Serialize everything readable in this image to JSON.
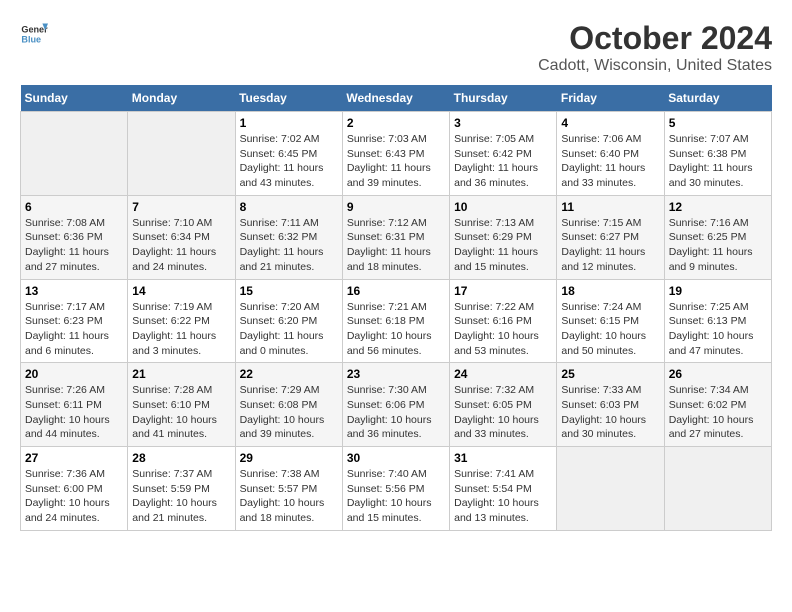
{
  "header": {
    "logo_line1": "General",
    "logo_line2": "Blue",
    "title": "October 2024",
    "subtitle": "Cadott, Wisconsin, United States"
  },
  "weekdays": [
    "Sunday",
    "Monday",
    "Tuesday",
    "Wednesday",
    "Thursday",
    "Friday",
    "Saturday"
  ],
  "weeks": [
    [
      {
        "day": "",
        "info": ""
      },
      {
        "day": "",
        "info": ""
      },
      {
        "day": "1",
        "info": "Sunrise: 7:02 AM\nSunset: 6:45 PM\nDaylight: 11 hours and 43 minutes."
      },
      {
        "day": "2",
        "info": "Sunrise: 7:03 AM\nSunset: 6:43 PM\nDaylight: 11 hours and 39 minutes."
      },
      {
        "day": "3",
        "info": "Sunrise: 7:05 AM\nSunset: 6:42 PM\nDaylight: 11 hours and 36 minutes."
      },
      {
        "day": "4",
        "info": "Sunrise: 7:06 AM\nSunset: 6:40 PM\nDaylight: 11 hours and 33 minutes."
      },
      {
        "day": "5",
        "info": "Sunrise: 7:07 AM\nSunset: 6:38 PM\nDaylight: 11 hours and 30 minutes."
      }
    ],
    [
      {
        "day": "6",
        "info": "Sunrise: 7:08 AM\nSunset: 6:36 PM\nDaylight: 11 hours and 27 minutes."
      },
      {
        "day": "7",
        "info": "Sunrise: 7:10 AM\nSunset: 6:34 PM\nDaylight: 11 hours and 24 minutes."
      },
      {
        "day": "8",
        "info": "Sunrise: 7:11 AM\nSunset: 6:32 PM\nDaylight: 11 hours and 21 minutes."
      },
      {
        "day": "9",
        "info": "Sunrise: 7:12 AM\nSunset: 6:31 PM\nDaylight: 11 hours and 18 minutes."
      },
      {
        "day": "10",
        "info": "Sunrise: 7:13 AM\nSunset: 6:29 PM\nDaylight: 11 hours and 15 minutes."
      },
      {
        "day": "11",
        "info": "Sunrise: 7:15 AM\nSunset: 6:27 PM\nDaylight: 11 hours and 12 minutes."
      },
      {
        "day": "12",
        "info": "Sunrise: 7:16 AM\nSunset: 6:25 PM\nDaylight: 11 hours and 9 minutes."
      }
    ],
    [
      {
        "day": "13",
        "info": "Sunrise: 7:17 AM\nSunset: 6:23 PM\nDaylight: 11 hours and 6 minutes."
      },
      {
        "day": "14",
        "info": "Sunrise: 7:19 AM\nSunset: 6:22 PM\nDaylight: 11 hours and 3 minutes."
      },
      {
        "day": "15",
        "info": "Sunrise: 7:20 AM\nSunset: 6:20 PM\nDaylight: 11 hours and 0 minutes."
      },
      {
        "day": "16",
        "info": "Sunrise: 7:21 AM\nSunset: 6:18 PM\nDaylight: 10 hours and 56 minutes."
      },
      {
        "day": "17",
        "info": "Sunrise: 7:22 AM\nSunset: 6:16 PM\nDaylight: 10 hours and 53 minutes."
      },
      {
        "day": "18",
        "info": "Sunrise: 7:24 AM\nSunset: 6:15 PM\nDaylight: 10 hours and 50 minutes."
      },
      {
        "day": "19",
        "info": "Sunrise: 7:25 AM\nSunset: 6:13 PM\nDaylight: 10 hours and 47 minutes."
      }
    ],
    [
      {
        "day": "20",
        "info": "Sunrise: 7:26 AM\nSunset: 6:11 PM\nDaylight: 10 hours and 44 minutes."
      },
      {
        "day": "21",
        "info": "Sunrise: 7:28 AM\nSunset: 6:10 PM\nDaylight: 10 hours and 41 minutes."
      },
      {
        "day": "22",
        "info": "Sunrise: 7:29 AM\nSunset: 6:08 PM\nDaylight: 10 hours and 39 minutes."
      },
      {
        "day": "23",
        "info": "Sunrise: 7:30 AM\nSunset: 6:06 PM\nDaylight: 10 hours and 36 minutes."
      },
      {
        "day": "24",
        "info": "Sunrise: 7:32 AM\nSunset: 6:05 PM\nDaylight: 10 hours and 33 minutes."
      },
      {
        "day": "25",
        "info": "Sunrise: 7:33 AM\nSunset: 6:03 PM\nDaylight: 10 hours and 30 minutes."
      },
      {
        "day": "26",
        "info": "Sunrise: 7:34 AM\nSunset: 6:02 PM\nDaylight: 10 hours and 27 minutes."
      }
    ],
    [
      {
        "day": "27",
        "info": "Sunrise: 7:36 AM\nSunset: 6:00 PM\nDaylight: 10 hours and 24 minutes."
      },
      {
        "day": "28",
        "info": "Sunrise: 7:37 AM\nSunset: 5:59 PM\nDaylight: 10 hours and 21 minutes."
      },
      {
        "day": "29",
        "info": "Sunrise: 7:38 AM\nSunset: 5:57 PM\nDaylight: 10 hours and 18 minutes."
      },
      {
        "day": "30",
        "info": "Sunrise: 7:40 AM\nSunset: 5:56 PM\nDaylight: 10 hours and 15 minutes."
      },
      {
        "day": "31",
        "info": "Sunrise: 7:41 AM\nSunset: 5:54 PM\nDaylight: 10 hours and 13 minutes."
      },
      {
        "day": "",
        "info": ""
      },
      {
        "day": "",
        "info": ""
      }
    ]
  ]
}
